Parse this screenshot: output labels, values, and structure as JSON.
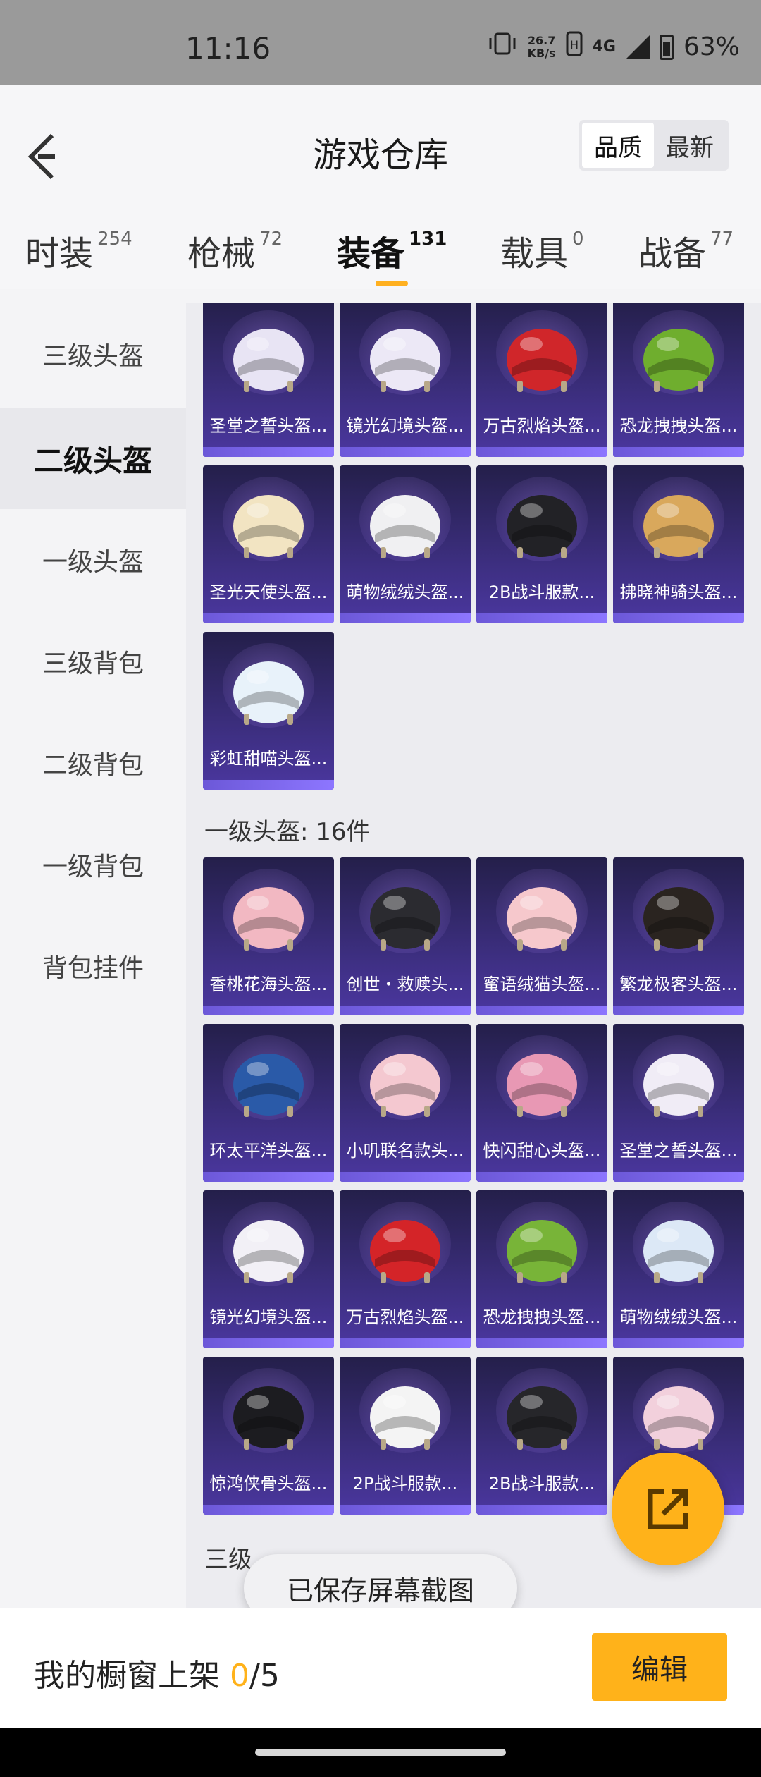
{
  "status_bar": {
    "time": "11:16",
    "net_speed_value": "26.7",
    "net_speed_unit": "KB/s",
    "network": "4G",
    "battery": "63%",
    "icons": [
      "vibrate-icon",
      "hd-icon",
      "signal-icon",
      "battery-icon"
    ]
  },
  "header": {
    "title": "游戏仓库",
    "sort_options": [
      {
        "label": "品质",
        "active": true
      },
      {
        "label": "最新",
        "active": false
      }
    ]
  },
  "category_tabs": [
    {
      "label": "时装",
      "count": "254",
      "active": false
    },
    {
      "label": "枪械",
      "count": "72",
      "active": false
    },
    {
      "label": "装备",
      "count": "131",
      "active": true
    },
    {
      "label": "载具",
      "count": "0",
      "active": false
    },
    {
      "label": "战备",
      "count": "77",
      "active": false
    }
  ],
  "sidebar": {
    "items": [
      {
        "label": "三级头盔",
        "active": false
      },
      {
        "label": "二级头盔",
        "active": true
      },
      {
        "label": "一级头盔",
        "active": false
      },
      {
        "label": "三级背包",
        "active": false
      },
      {
        "label": "二级背包",
        "active": false
      },
      {
        "label": "一级背包",
        "active": false
      },
      {
        "label": "背包挂件",
        "active": false
      }
    ]
  },
  "level2_items": [
    {
      "name": "圣堂之誓头盔...",
      "icon": "helmet-icon",
      "color": "#e8e4f4"
    },
    {
      "name": "镜光幻境头盔...",
      "icon": "helmet-icon",
      "color": "#ece8f6"
    },
    {
      "name": "万古烈焰头盔...",
      "icon": "helmet-icon",
      "color": "#d0262a"
    },
    {
      "name": "恐龙拽拽头盔...",
      "icon": "helmet-icon",
      "color": "#6fae2e"
    },
    {
      "name": "圣光天使头盔...",
      "icon": "helmet-icon",
      "color": "#f2e4c2"
    },
    {
      "name": "萌物绒绒头盔...",
      "icon": "helmet-icon",
      "color": "#f0f0f2"
    },
    {
      "name": "2B战斗服款...",
      "icon": "helmet-icon",
      "color": "#222226"
    },
    {
      "name": "拂晓神骑头盔...",
      "icon": "helmet-icon",
      "color": "#d9a85c"
    },
    {
      "name": "彩虹甜喵头盔...",
      "icon": "helmet-icon",
      "color": "#e8f2fa"
    }
  ],
  "level1_section_title": "一级头盔: 16件",
  "level1_items": [
    {
      "name": "香桃花海头盔...",
      "icon": "helmet-icon",
      "color": "#f2b8c2"
    },
    {
      "name": "创世・救赎头...",
      "icon": "helmet-icon",
      "color": "#2b2b30"
    },
    {
      "name": "蜜语绒猫头盔...",
      "icon": "helmet-icon",
      "color": "#f6c8cc"
    },
    {
      "name": "繁龙极客头盔...",
      "icon": "helmet-icon",
      "color": "#2a2420"
    },
    {
      "name": "环太平洋头盔...",
      "icon": "helmet-icon",
      "color": "#2a5aa8"
    },
    {
      "name": "小叽联名款头...",
      "icon": "helmet-icon",
      "color": "#f4c8d0"
    },
    {
      "name": "快闪甜心头盔...",
      "icon": "helmet-icon",
      "color": "#e898b4"
    },
    {
      "name": "圣堂之誓头盔...",
      "icon": "helmet-icon",
      "color": "#f0ecf6"
    },
    {
      "name": "镜光幻境头盔...",
      "icon": "helmet-icon",
      "color": "#f2f0f6"
    },
    {
      "name": "万古烈焰头盔...",
      "icon": "helmet-icon",
      "color": "#d42428"
    },
    {
      "name": "恐龙拽拽头盔...",
      "icon": "helmet-icon",
      "color": "#78b438"
    },
    {
      "name": "萌物绒绒头盔...",
      "icon": "helmet-icon",
      "color": "#dce8f6"
    },
    {
      "name": "惊鸿侠骨头盔...",
      "icon": "helmet-icon",
      "color": "#1c1c20"
    },
    {
      "name": "2P战斗服款...",
      "icon": "helmet-icon",
      "color": "#f4f4f4"
    },
    {
      "name": "2B战斗服款...",
      "icon": "helmet-icon",
      "color": "#26262a"
    },
    {
      "name": "",
      "icon": "helmet-icon",
      "color": "#f2d0dc"
    }
  ],
  "next_section_title": "三级",
  "toast": "已保存屏幕截图",
  "bottom_bar": {
    "label": "我的橱窗上架 ",
    "current": "0",
    "total": "/5",
    "edit_label": "编辑"
  }
}
